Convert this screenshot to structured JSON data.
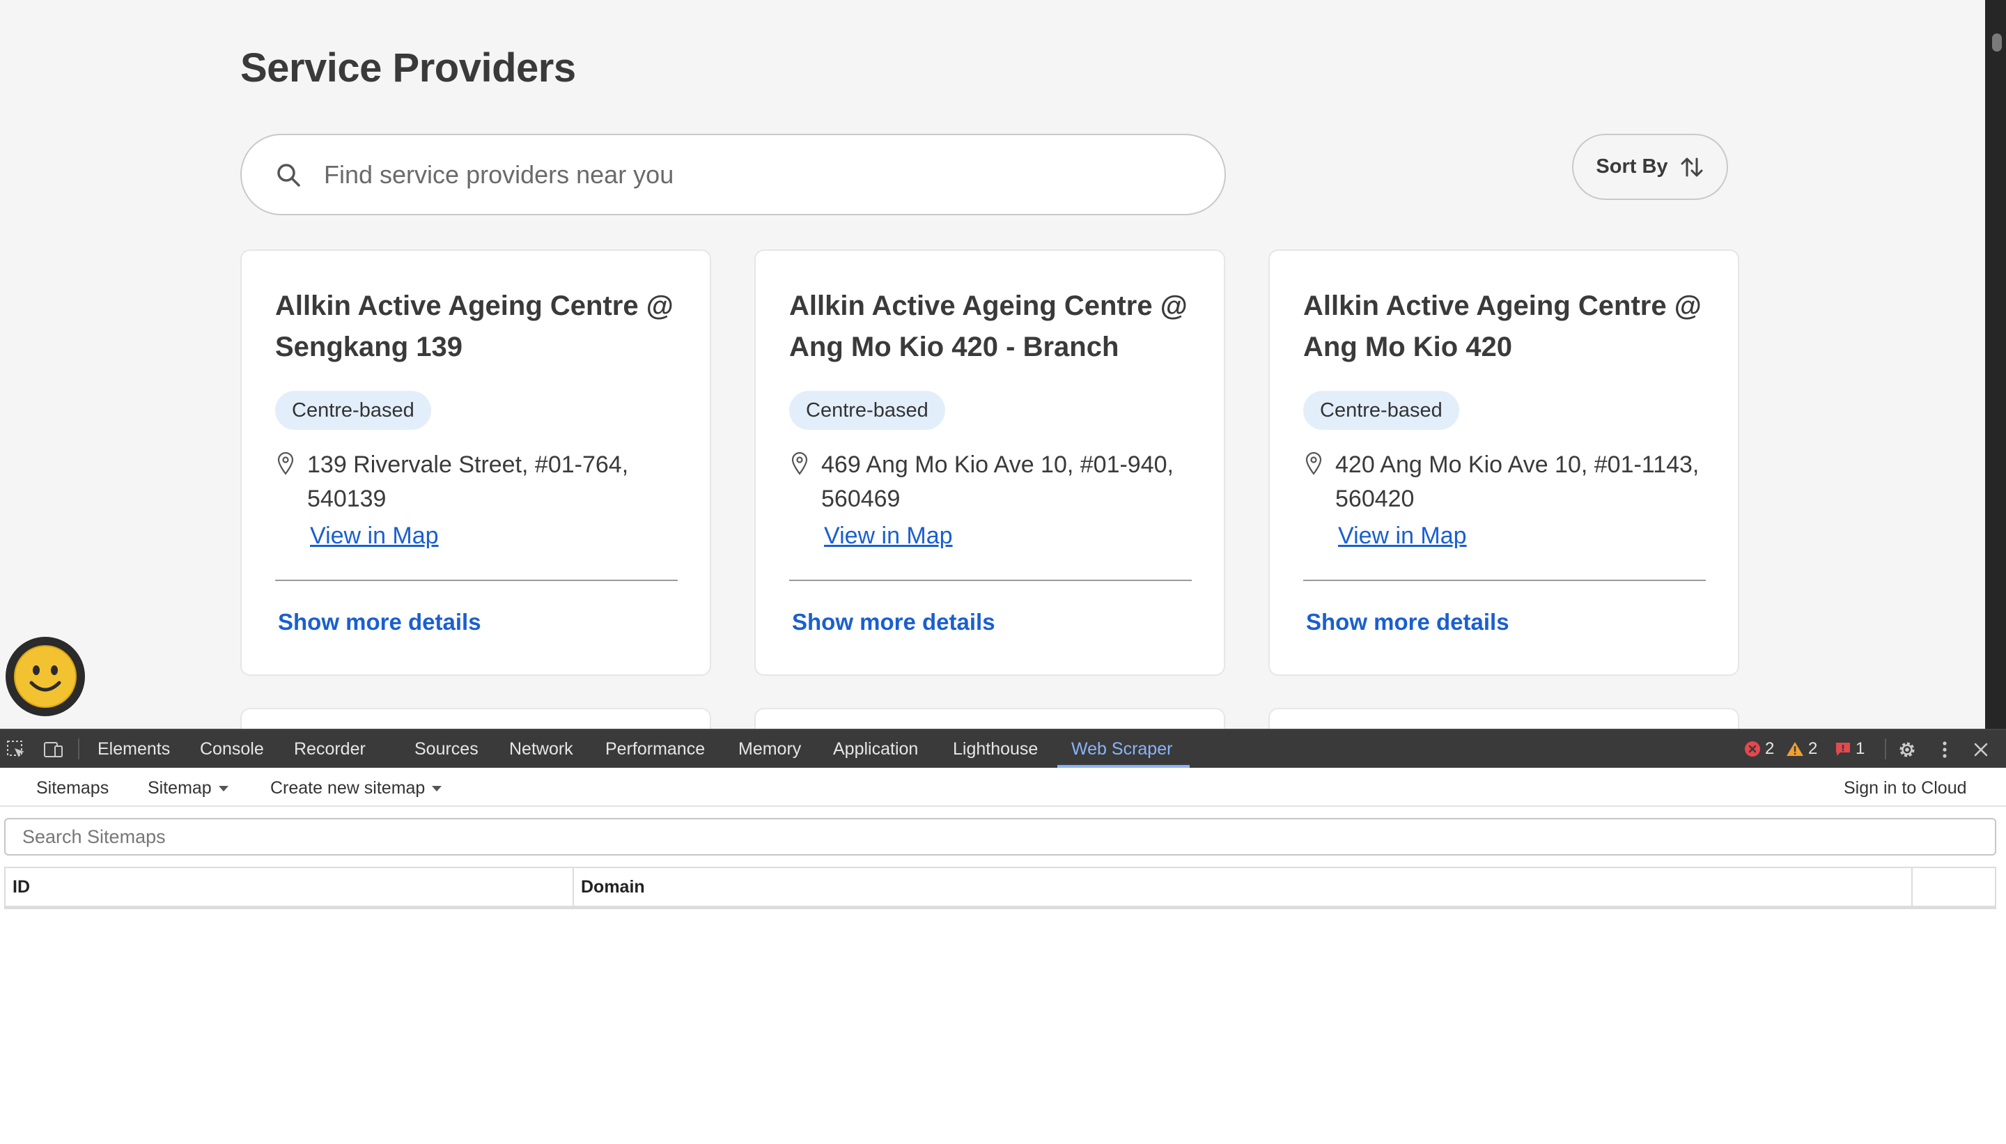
{
  "page": {
    "title": "Service Providers",
    "search_placeholder": "Find service providers near you",
    "sort_label": "Sort By"
  },
  "providers": [
    {
      "name": "Allkin Active Ageing Centre @ Sengkang 139",
      "type": "Centre-based",
      "address": "139 Rivervale Street, #01-764, 540139",
      "map_link": "View in Map",
      "details_link": "Show more details"
    },
    {
      "name": "Allkin Active Ageing Centre @ Ang Mo Kio 420 - Branch",
      "type": "Centre-based",
      "address": "469 Ang Mo Kio Ave 10, #01-940, 560469",
      "map_link": "View in Map",
      "details_link": "Show more details"
    },
    {
      "name": "Allkin Active Ageing Centre @ Ang Mo Kio 420",
      "type": "Centre-based",
      "address": "420 Ang Mo Kio Ave 10, #01-1143, 560420",
      "map_link": "View in Map",
      "details_link": "Show more details"
    }
  ],
  "devtools": {
    "tabs": [
      "Elements",
      "Console",
      "Recorder",
      "Sources",
      "Network",
      "Performance",
      "Memory",
      "Application",
      "Lighthouse",
      "Web Scraper"
    ],
    "active_tab": "Web Scraper",
    "error_count": "2",
    "warning_count": "2",
    "issue_count": "1"
  },
  "web_scraper": {
    "nav": {
      "sitemaps": "Sitemaps",
      "sitemap": "Sitemap",
      "create_new_sitemap": "Create new sitemap",
      "sign_in": "Sign in to Cloud"
    },
    "search_placeholder": "Search Sitemaps",
    "columns": [
      "ID",
      "Domain"
    ]
  },
  "colors": {
    "link": "#1a5fd0",
    "badge_bg": "#e3eefb",
    "devtools_bar": "#3a3a3a",
    "active_tab": "#8ab4f8",
    "error": "#e5484d",
    "warning": "#f0a030"
  },
  "icons": [
    "search-icon",
    "sort-icon",
    "location-pin-icon",
    "smiley-icon",
    "inspect-element-icon",
    "device-toggle-icon",
    "error-icon",
    "warning-icon",
    "issue-icon",
    "gear-icon",
    "more-vertical-icon",
    "close-icon"
  ]
}
